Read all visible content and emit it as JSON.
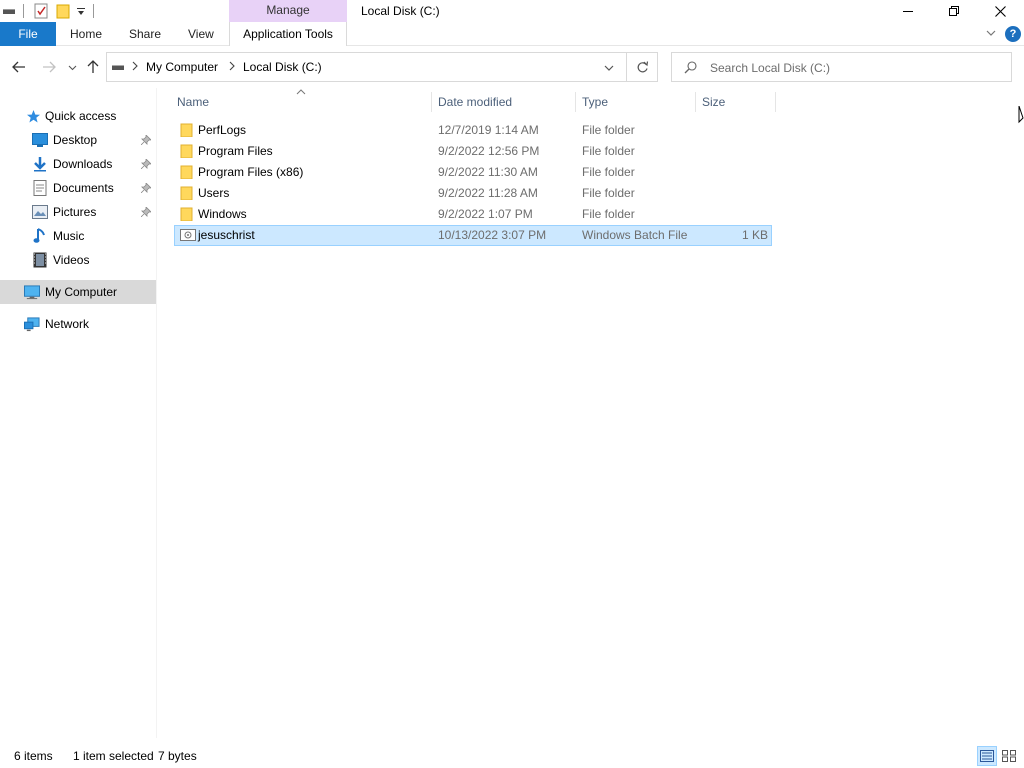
{
  "window": {
    "title": "Local Disk (C:)",
    "context_tab_group": "Manage",
    "controls": {
      "minimize": "minimize",
      "maximize": "maximize",
      "close": "close"
    }
  },
  "ribbon": {
    "file_label": "File",
    "tabs": [
      "Home",
      "Share",
      "View"
    ],
    "context_tab": "Application Tools",
    "help_label": "?"
  },
  "address": {
    "drive_icon": "drive-icon",
    "crumbs": [
      "My Computer",
      "Local Disk (C:)"
    ]
  },
  "search": {
    "placeholder": "Search Local Disk (C:)"
  },
  "navpane": {
    "quick_access": "Quick access",
    "pinned": [
      {
        "label": "Desktop",
        "icon": "desktop-icon",
        "pinned": true
      },
      {
        "label": "Downloads",
        "icon": "downloads-icon",
        "pinned": true
      },
      {
        "label": "Documents",
        "icon": "documents-icon",
        "pinned": true
      },
      {
        "label": "Pictures",
        "icon": "pictures-icon",
        "pinned": true
      },
      {
        "label": "Music",
        "icon": "music-icon",
        "pinned": false
      },
      {
        "label": "Videos",
        "icon": "videos-icon",
        "pinned": false
      }
    ],
    "this_pc": "My Computer",
    "network": "Network"
  },
  "columns": {
    "name": "Name",
    "date": "Date modified",
    "type": "Type",
    "size": "Size"
  },
  "files": [
    {
      "name": "PerfLogs",
      "date": "12/7/2019 1:14 AM",
      "type": "File folder",
      "size": "",
      "icon": "folder-icon",
      "selected": false
    },
    {
      "name": "Program Files",
      "date": "9/2/2022 12:56 PM",
      "type": "File folder",
      "size": "",
      "icon": "folder-icon",
      "selected": false
    },
    {
      "name": "Program Files (x86)",
      "date": "9/2/2022 11:30 AM",
      "type": "File folder",
      "size": "",
      "icon": "folder-icon",
      "selected": false
    },
    {
      "name": "Users",
      "date": "9/2/2022 11:28 AM",
      "type": "File folder",
      "size": "",
      "icon": "folder-icon",
      "selected": false
    },
    {
      "name": "Windows",
      "date": "9/2/2022 1:07 PM",
      "type": "File folder",
      "size": "",
      "icon": "folder-icon",
      "selected": false
    },
    {
      "name": "jesuschrist",
      "date": "10/13/2022 3:07 PM",
      "type": "Windows Batch File",
      "size": "1 KB",
      "icon": "batch-file-icon",
      "selected": true
    }
  ],
  "status": {
    "item_count": "6 items",
    "selection": "1 item selected",
    "selection_size": "7 bytes"
  },
  "colors": {
    "file_tab": "#1979ca",
    "manage_tab": "#e8d2f7",
    "selection_fill": "#cce8ff",
    "selection_border": "#99d1ff",
    "folder_yellow": "#ffd85c",
    "nav_selected": "#d9d9d9"
  }
}
